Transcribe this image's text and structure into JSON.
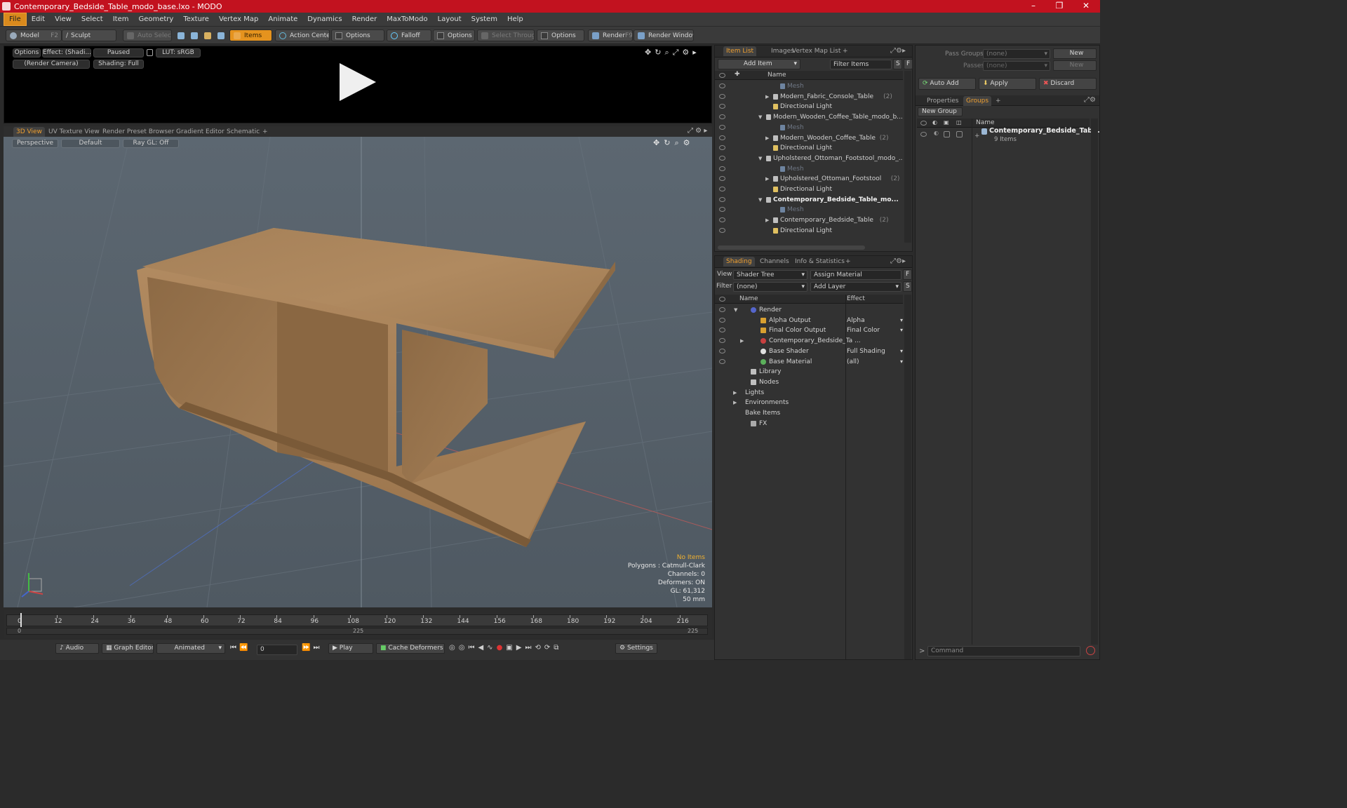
{
  "window": {
    "title": "Contemporary_Bedside_Table_modo_base.lxo - MODO",
    "min": "–",
    "max": "❐",
    "close": "✕"
  },
  "menu": [
    "File",
    "Edit",
    "View",
    "Select",
    "Item",
    "Geometry",
    "Texture",
    "Vertex Map",
    "Animate",
    "Dynamics",
    "Render",
    "MaxToModo",
    "Layout",
    "System",
    "Help"
  ],
  "toolbar": {
    "model": "Model",
    "model_key": "F2",
    "sculpt": "Sculpt",
    "auto_select": "Auto Select",
    "items": "Items",
    "action_center": "Action Center",
    "options1": "Options",
    "falloff": "Falloff",
    "options2": "Options",
    "select_through": "Select Through",
    "options3": "Options",
    "render": "Render",
    "render_key": "F9",
    "render_window": "Render Window"
  },
  "render_preview": {
    "options": "Options",
    "effect": "Effect: (Shadi...",
    "paused": "Paused",
    "lut": "LUT: sRGB",
    "camera": "(Render Camera)",
    "shading": "Shading: Full"
  },
  "view_tabs": [
    "3D View",
    "UV Texture View",
    "Render Preset Browser",
    "Gradient Editor",
    "Schematic",
    "+"
  ],
  "viewport": {
    "perspective": "Perspective",
    "default": "Default",
    "raygl": "Ray GL: Off",
    "stats": [
      "No Items",
      "Polygons : Catmull-Clark",
      "Channels: 0",
      "Deformers: ON",
      "GL: 61,312",
      "50 mm"
    ]
  },
  "timeline": {
    "ticks": [
      "0",
      "12",
      "24",
      "36",
      "48",
      "60",
      "72",
      "84",
      "96",
      "108",
      "120",
      "132",
      "144",
      "156",
      "168",
      "180",
      "192",
      "204",
      "216"
    ],
    "bottom": [
      "0",
      "225",
      "225"
    ]
  },
  "transport": {
    "audio": "Audio",
    "graph_editor": "Graph Editor",
    "animated": "Animated",
    "frame": "0",
    "play": "Play",
    "cache": "Cache Deformers",
    "settings": "Settings"
  },
  "item_list": {
    "tabs": [
      "Item List",
      "Images",
      "Vertex Map List",
      "+"
    ],
    "add_item": "Add Item",
    "filter": "Filter Items",
    "s": "S",
    "f": "F",
    "name_col": "Name",
    "rows": [
      {
        "label": "Mesh",
        "indent": 3,
        "dim": true
      },
      {
        "label": "Modern_Fabric_Console_Table",
        "count": "(2)",
        "indent": 2,
        "arrow": "▶"
      },
      {
        "label": "Directional Light",
        "indent": 2
      },
      {
        "label": "Modern_Wooden_Coffee_Table_modo_b...",
        "indent": 1,
        "arrow": "▼"
      },
      {
        "label": "Mesh",
        "indent": 3,
        "dim": true
      },
      {
        "label": "Modern_Wooden_Coffee_Table",
        "count": "(2)",
        "indent": 2,
        "arrow": "▶"
      },
      {
        "label": "Directional Light",
        "indent": 2
      },
      {
        "label": "Upholstered_Ottoman_Footstool_modo_...",
        "indent": 1,
        "arrow": "▼"
      },
      {
        "label": "Mesh",
        "indent": 3,
        "dim": true
      },
      {
        "label": "Upholstered_Ottoman_Footstool",
        "count": "(2)",
        "indent": 2,
        "arrow": "▶"
      },
      {
        "label": "Directional Light",
        "indent": 2
      },
      {
        "label": "Contemporary_Bedside_Table_mo...",
        "indent": 1,
        "arrow": "▼",
        "bold": true
      },
      {
        "label": "Mesh",
        "indent": 3,
        "dim": true
      },
      {
        "label": "Contemporary_Bedside_Table",
        "count": "(2)",
        "indent": 2,
        "arrow": "▶"
      },
      {
        "label": "Directional Light",
        "indent": 2
      }
    ]
  },
  "shading": {
    "tabs": [
      "Shading",
      "Channels",
      "Info & Statistics",
      "+"
    ],
    "view_label": "View",
    "view_value": "Shader Tree",
    "assign": "Assign Material",
    "f": "F",
    "filter_label": "Filter",
    "filter_value": "(none)",
    "add_layer": "Add Layer",
    "s": "S",
    "col_name": "Name",
    "col_effect": "Effect",
    "rows": [
      {
        "label": "Render",
        "effect": "",
        "indent": 0
      },
      {
        "label": "Alpha Output",
        "effect": "Alpha",
        "indent": 1
      },
      {
        "label": "Final Color Output",
        "effect": "Final Color",
        "indent": 1
      },
      {
        "label": "Contemporary_Bedside_Ta ...",
        "effect": "",
        "indent": 1
      },
      {
        "label": "Base Shader",
        "effect": "Full Shading",
        "indent": 1
      },
      {
        "label": "Base Material",
        "effect": "(all)",
        "indent": 1
      },
      {
        "label": "Library",
        "effect": "",
        "indent": 0
      },
      {
        "label": "Nodes",
        "effect": "",
        "indent": 0
      },
      {
        "label": "Lights",
        "effect": "",
        "indent": -1
      },
      {
        "label": "Environments",
        "effect": "",
        "indent": -1
      },
      {
        "label": "Bake Items",
        "effect": "",
        "indent": -1
      },
      {
        "label": "FX",
        "effect": "",
        "indent": 0
      }
    ]
  },
  "groups": {
    "pass_groups": "Pass Groups",
    "pass_groups_value": "(none)",
    "new1": "New",
    "passes": "Passes",
    "passes_value": "(none)",
    "new2": "New",
    "auto_add": "Auto Add",
    "apply": "Apply",
    "discard": "Discard",
    "tabs": [
      "Properties",
      "Groups",
      "+"
    ],
    "new_group": "New Group",
    "name_col": "Name",
    "group_name": "Contemporary_Bedside_Tab...",
    "group_count": "9 Items",
    "command": "Command"
  },
  "colors": {
    "title_red": "#c2121f",
    "accent_orange": "#e5931e",
    "wood": "#a9825a"
  }
}
